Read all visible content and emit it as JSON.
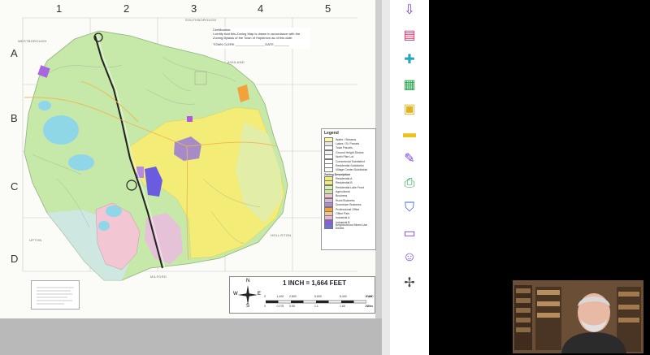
{
  "map": {
    "grid_columns": [
      "1",
      "2",
      "3",
      "4",
      "5"
    ],
    "grid_rows": [
      "A",
      "B",
      "C",
      "D"
    ],
    "certification": {
      "title": "Certification:",
      "text": "I certify that this Zoning Map is drawn in accordance with the Zoning Bylaws of the Town of Hopkinton as of this date:",
      "signature_line": "TOWN CLERK ________________  DATE ________"
    },
    "town_labels": {
      "southborough": "SOUTHBOROUGH",
      "westborough": "WESTBOROUGH",
      "ashland": "ASHLAND",
      "upton": "UPTON",
      "holliston": "HOLLISTON",
      "milford": "MILFORD"
    },
    "legend": {
      "title": "Legend",
      "items": [
        {
          "label": "Water / Streams",
          "color": "#fff6a8"
        },
        {
          "label": "Lakes / St. Parcels",
          "color": "#e8e8e8"
        },
        {
          "label": "Town Parcels",
          "color": "#ffffff"
        },
        {
          "label": "Ground Height District",
          "color": "#f2f2f2"
        },
        {
          "label": "North Pike Lot",
          "color": "#ffffff"
        },
        {
          "label": "Commercial Subdistrict",
          "color": "#ffffff"
        },
        {
          "label": "Residential Subdistrict",
          "color": "#ffffff"
        },
        {
          "label": "Village Center Subdistrict",
          "color": "#ffffff"
        }
      ],
      "zoning_title": "Zoning Description",
      "zoning": [
        {
          "label": "Residential A",
          "color": "#f3ec76"
        },
        {
          "label": "Residential B",
          "color": "#ecef7c"
        },
        {
          "label": "Residential Lake Front",
          "color": "#d9efb2"
        },
        {
          "label": "Agricultural",
          "color": "#c8e7a7"
        },
        {
          "label": "Business",
          "color": "#f7c2cf"
        },
        {
          "label": "Rural Business",
          "color": "#d6b6d6"
        },
        {
          "label": "Downtown Business",
          "color": "#b08ad0"
        },
        {
          "label": "Professional Office",
          "color": "#f2a23a"
        },
        {
          "label": "Office Park",
          "color": "#f5c48a"
        },
        {
          "label": "Industrial A",
          "color": "#e0b4ea"
        },
        {
          "label": "Industrial B",
          "color": "#8a5ce0"
        },
        {
          "label": "Neighborhood Mixed Use District",
          "color": "#6c74d8"
        }
      ]
    },
    "scale": {
      "title": "1 INCH = 1,664 FEET",
      "feet_ticks": [
        "0",
        "1,400",
        "2,800",
        "",
        "5,600",
        "",
        "8,400",
        "",
        "11,200"
      ],
      "miles_ticks": [
        "0",
        "0.275",
        "0.55",
        "",
        "1.1",
        "",
        "1.65",
        "",
        "2.2"
      ],
      "feet_unit": "Feet",
      "miles_unit": "Miles"
    },
    "compass": {
      "n": "N",
      "s": "S",
      "e": "E",
      "w": "W"
    }
  },
  "toolbar": {
    "tools": [
      {
        "name": "export-pdf-icon",
        "color": "#7b3fe0"
      },
      {
        "name": "organize-pages-icon",
        "color": "#e0336a"
      },
      {
        "name": "create-pdf-icon",
        "color": "#2aa5b5"
      },
      {
        "name": "edit-pdf-icon",
        "color": "#26a84c"
      },
      {
        "name": "combine-files-icon",
        "color": "#e5b21c"
      },
      {
        "name": "comment-icon",
        "color": "#f0c21a"
      },
      {
        "name": "fill-sign-icon",
        "color": "#7b3fe0"
      },
      {
        "name": "print-production-icon",
        "color": "#26a84c"
      },
      {
        "name": "protect-icon",
        "color": "#4a5fd8"
      },
      {
        "name": "measure-icon",
        "color": "#7b3fe0"
      },
      {
        "name": "accessibility-icon",
        "color": "#7b3fe0"
      },
      {
        "name": "more-tools-icon",
        "color": "#444444"
      }
    ]
  }
}
